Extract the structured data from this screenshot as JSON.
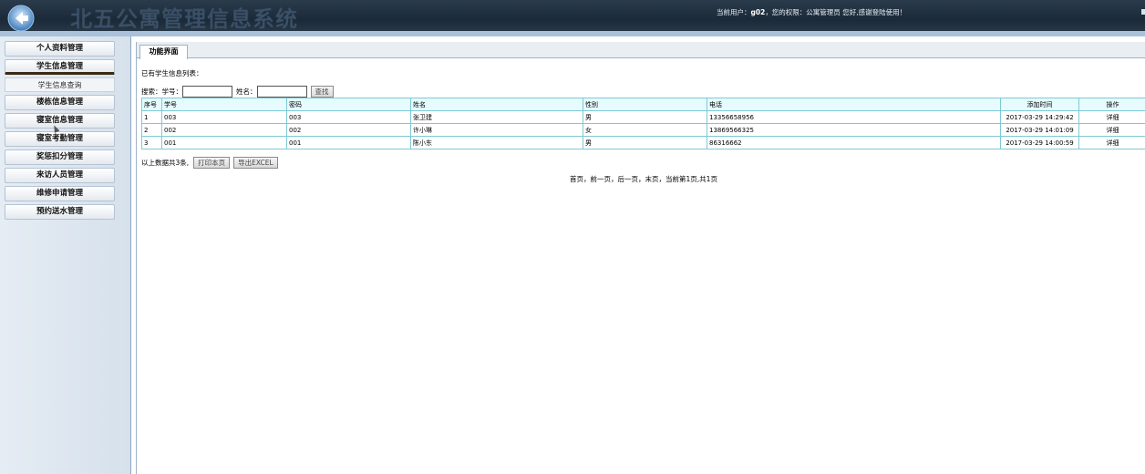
{
  "header": {
    "title": "北五公寓管理信息系统",
    "user_prefix": "当前用户：",
    "username": "g02",
    "user_suffix": "，您的权限：公寓管理员 您好,感谢登陆使用！"
  },
  "sidebar": {
    "items": [
      {
        "label": "个人资料管理"
      },
      {
        "label": "学生信息管理"
      },
      {
        "label": "学生信息查询"
      },
      {
        "label": "楼栋信息管理"
      },
      {
        "label": "寝室信息管理"
      },
      {
        "label": "寝室考勤管理"
      },
      {
        "label": "奖惩扣分管理"
      },
      {
        "label": "来访人员管理"
      },
      {
        "label": "维修申请管理"
      },
      {
        "label": "预约送水管理"
      }
    ]
  },
  "tab": {
    "label": "功能界面"
  },
  "list": {
    "title": "已有学生信息列表：",
    "search_label": "搜索：",
    "student_no_label": "学号：",
    "name_label": "姓名：",
    "student_no_value": "",
    "name_value": "",
    "search_button": "查找"
  },
  "table": {
    "headers": [
      "序号",
      "学号",
      "密码",
      "姓名",
      "性别",
      "电话",
      "添加时间",
      "操作"
    ],
    "rows": [
      {
        "idx": "1",
        "no": "003",
        "pwd": "003",
        "name": "张卫建",
        "sex": "男",
        "phone": "13356658956",
        "time": "2017-03-29 14:29:42",
        "op": "详细"
      },
      {
        "idx": "2",
        "no": "002",
        "pwd": "002",
        "name": "许小琳",
        "sex": "女",
        "phone": "13869566325",
        "time": "2017-03-29 14:01:09",
        "op": "详细"
      },
      {
        "idx": "3",
        "no": "001",
        "pwd": "001",
        "name": "陈小东",
        "sex": "男",
        "phone": "86316662",
        "time": "2017-03-29 14:00:59",
        "op": "详细"
      }
    ]
  },
  "footer": {
    "count_text": "以上数据共3条,",
    "print_button": "打印本页",
    "export_button": "导出EXCEL",
    "pager_text": "首页，前一页，后一页，末页，当前第1页,共1页"
  },
  "colors": {
    "header_bg": "#1b2a38",
    "table_border": "#7fc9d6",
    "table_header_bg": "#e6fbfd"
  }
}
